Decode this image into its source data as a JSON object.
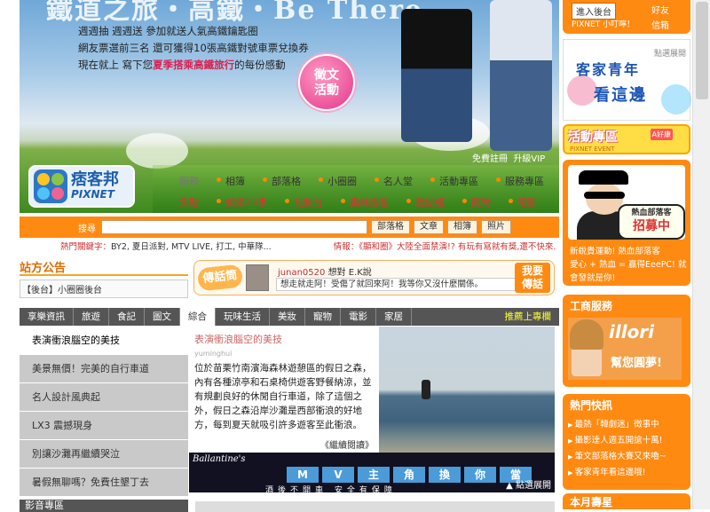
{
  "hero": {
    "title": "鐵道之旅・高鐵・Be There",
    "promo_lines": [
      "週週抽 週週送 參加就送人氣高鐵鑰匙圈",
      "網友票選前三名 還可獲得10張高鐵對號車票兌換券"
    ],
    "promo_last_prefix": "現在就上 寫下您",
    "promo_last_highlight": "夏季搭乘高鐵旅行",
    "promo_last_suffix": "的每份感動",
    "stamp_line1": "徵文",
    "stamp_line2": "活動",
    "link_free": "免費註冊",
    "link_vip": "升級VIP"
  },
  "logo": {
    "name": "痞客邦",
    "sub": "PIXNET"
  },
  "nav_top": [
    "服務",
    "相簿",
    "部落格",
    "小圈圈",
    "名人堂",
    "活動專區",
    "服務專區"
  ],
  "nav_bottom": [
    "焦點",
    "娛樂23事",
    "化妝台",
    "奧林痞客",
    "雜誌櫃",
    "寵物",
    "電影"
  ],
  "search": {
    "label": "搜尋",
    "buttons": [
      "部落格",
      "文章",
      "相簿",
      "照片"
    ]
  },
  "hot_keywords": {
    "label": "熱門關鍵字：",
    "items": "BY2, 夏日派對, MTV LIVE, 打工, 中華隊...",
    "news_label": "情報：",
    "news": "《顯和圈》大陸全面禁演!? 有玩有寫就有獎,還不快來."
  },
  "notice": {
    "title": "站方公告",
    "item": "【後台】小圈圈後台"
  },
  "chat": {
    "tag": "傳話筒",
    "user": "junan0520",
    "verb": "想對",
    "target": "E.K說",
    "message": "想走就走阿！受傷了就回來阿！我等你又沒什麼關係。",
    "button_l1": "我要",
    "button_l2": "傳話"
  },
  "tabs": [
    "享樂資訊",
    "旅遊",
    "食記",
    "圖文",
    "綜合",
    "玩味生活",
    "美妝",
    "寵物",
    "電影",
    "家居"
  ],
  "tabs_active": "綜合",
  "tabs_back": "推薦上專欄",
  "left_list": [
    "表演衝浪腦空的美技",
    "美景無價！完美的自行車道",
    "名人設計風典起",
    "LX3 震撼現身",
    "別讓沙灘再繼續哭泣",
    "暑假無聊嗎？免費住墾丁去"
  ],
  "article": {
    "title": "表演衝浪腦空的美技",
    "author": "yuminghui",
    "body": "位於苗栗竹南濱海森林遊憩區的假日之森，內有各種涼亭和石桌椅供遊客野餐納涼，並有規劃良好的休閒自行車道，除了這個之外，假日之森沿岸沙灘是西部衝浪的好地方，每到夏天就吸引許多遊客至此衝浪。",
    "more": "《繼續閱讀》"
  },
  "banner": {
    "brand": "Ballantine's",
    "chars": [
      "M",
      "V",
      "主",
      "角",
      "換",
      "你",
      "當"
    ],
    "sub": "酒後不開車 安全有保障",
    "more": "點選展開"
  },
  "bottom_left": "影音專區",
  "right": {
    "login_btn": "進入後台",
    "login_hi": "好友",
    "login_user": "PIXNET 小叮嚀！",
    "login_mail": "信箱",
    "hakka_tag": "點選展開",
    "hakka_l1": "客家青年",
    "hakka_l2": "看這邊",
    "events_title": "活動專區",
    "events_sub": "PIXNET EVENT",
    "events_badge": "A好康",
    "recruit_bubble1": "熱血部落客",
    "recruit_bubble2": "招募中",
    "recruit_text": [
      "新銳貴運動! 熱血部落客",
      "愛心 + 熱血 = 贏得EeePC! 就",
      "會發就是你!"
    ],
    "service_title": "工商服務",
    "service_brand": "illori",
    "service_slogan": "幫您圓夢!",
    "hot_title": "熱門快訊",
    "hot_items": [
      "最熱「韓劇迷」徵事中",
      "攝影達人週五開搶十萬!",
      "筆文部落格大賽又來嚕~",
      "客家青年看這邊哦!"
    ],
    "birthday_title": "本月壽星"
  }
}
